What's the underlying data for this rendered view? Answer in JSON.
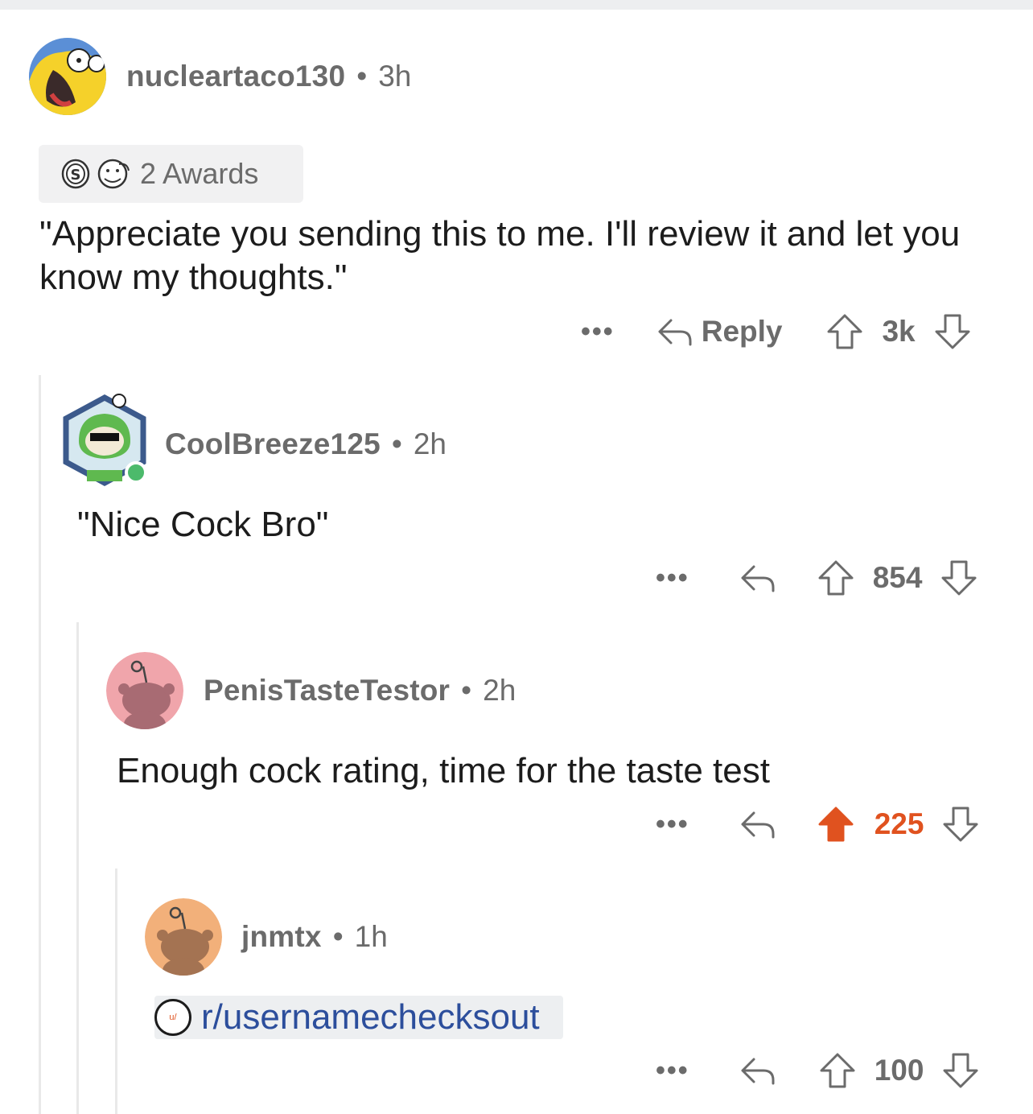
{
  "comments": [
    {
      "username": "nucleartaco130",
      "time": "3h",
      "awards_label": "2 Awards",
      "body": "\"Appreciate you sending this to me. I'll review it and let you know my thoughts.\"",
      "reply_label": "Reply",
      "score": "3k"
    },
    {
      "username": "CoolBreeze125",
      "time": "2h",
      "body": "\"Nice Cock Bro\"",
      "score": "854"
    },
    {
      "username": "PenisTasteTestor",
      "time": "2h",
      "body": "Enough cock rating, time for the taste test",
      "score": "225",
      "upvoted": true
    },
    {
      "username": "jnmtx",
      "time": "1h",
      "link_text": "r/usernamechecksout",
      "badge_text": "u/",
      "score": "100"
    }
  ],
  "separator": "•",
  "more_label": "•••",
  "colors": {
    "upvote_active": "#e0521f",
    "meta_gray": "#6b6b6b",
    "link_blue": "#2c4e9c"
  }
}
